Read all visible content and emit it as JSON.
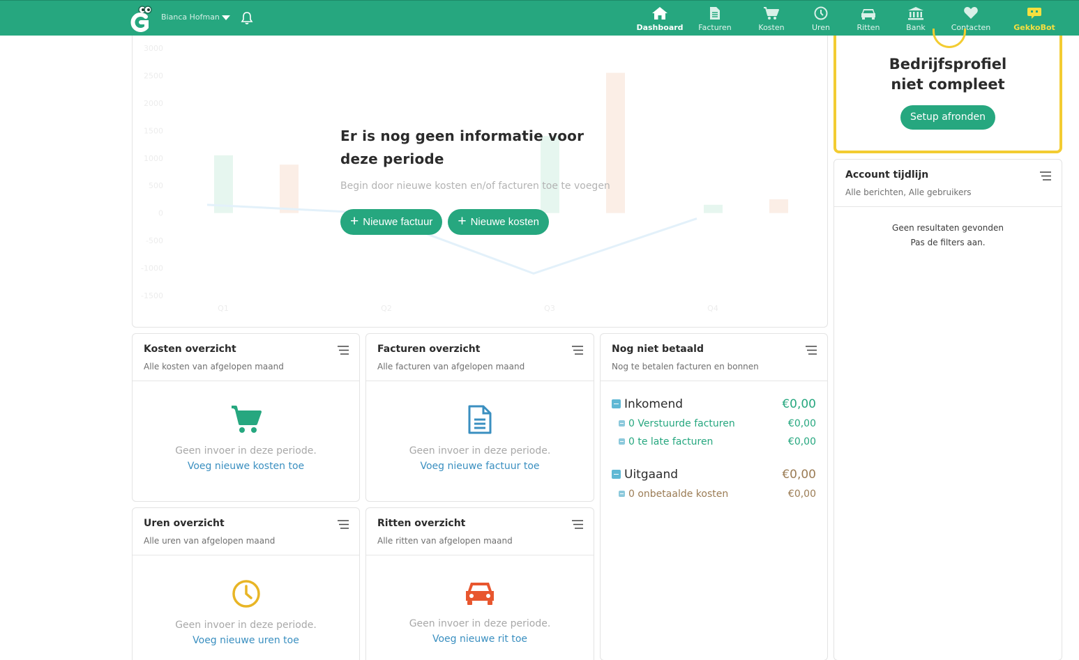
{
  "topbar": {
    "user_name": "Bianca Hofman",
    "nav": [
      {
        "label": "Dashboard",
        "icon": "home-icon"
      },
      {
        "label": "Facturen",
        "icon": "document-icon"
      },
      {
        "label": "Kosten",
        "icon": "cart-icon"
      },
      {
        "label": "Uren",
        "icon": "clock-icon"
      },
      {
        "label": "Ritten",
        "icon": "car-icon"
      },
      {
        "label": "Bank",
        "icon": "bank-icon"
      },
      {
        "label": "Contacten",
        "icon": "heart-icon"
      },
      {
        "label": "GekkoBot",
        "icon": "robot-icon"
      }
    ],
    "active": "Dashboard"
  },
  "colors": {
    "brand": "#26a77f",
    "accent_yellow": "#f3cc32",
    "link": "#3a8fc0",
    "expense_brown": "#9b7c55"
  },
  "chart_data": {
    "type": "bar",
    "categories": [
      "Q1",
      "Q2",
      "Q3",
      "Q4"
    ],
    "series": [
      {
        "values": [
          1050,
          0,
          1400,
          150
        ]
      },
      {
        "values": [
          880,
          0,
          2550,
          250
        ]
      }
    ],
    "line": [
      150,
      0,
      -1100,
      -100
    ],
    "yticks": [
      "3000",
      "2500",
      "2000",
      "1500",
      "1000",
      "500",
      "0",
      "-500",
      "-1000",
      "-1500"
    ],
    "ylim": [
      -1500,
      3000
    ],
    "faded": true
  },
  "empty_state": {
    "title": "Er is nog geen informatie voor deze periode",
    "subtitle": "Begin door nieuwe kosten en/of facturen toe te voegen",
    "new_invoice": "Nieuwe factuur",
    "new_costs": "Nieuwe kosten"
  },
  "cards": {
    "kosten": {
      "title": "Kosten overzicht",
      "sub": "Alle kosten van afgelopen maand",
      "empty": "Geen invoer in deze periode.",
      "link": "Voeg nieuwe kosten toe"
    },
    "facturen": {
      "title": "Facturen overzicht",
      "sub": "Alle facturen van afgelopen maand",
      "empty": "Geen invoer in deze periode.",
      "link": "Voeg nieuwe factuur toe"
    },
    "uren": {
      "title": "Uren overzicht",
      "sub": "Alle uren van afgelopen maand",
      "empty": "Geen invoer in deze periode.",
      "link": "Voeg nieuwe uren toe"
    },
    "ritten": {
      "title": "Ritten overzicht",
      "sub": "Alle ritten van afgelopen maand",
      "empty": "Geen invoer in deze periode.",
      "link": "Voeg nieuwe rit toe"
    }
  },
  "unpaid": {
    "title": "Nog niet betaald",
    "sub": "Nog te betalen facturen en bonnen",
    "incoming": {
      "label": "Inkomend",
      "amount": "€0,00",
      "rows": [
        {
          "label": "0 Verstuurde facturen",
          "amount": "€0,00"
        },
        {
          "label": "0 te late facturen",
          "amount": "€0,00"
        }
      ]
    },
    "outgoing": {
      "label": "Uitgaand",
      "amount": "€0,00",
      "rows": [
        {
          "label": "0 onbetaalde kosten",
          "amount": "€0,00"
        }
      ]
    }
  },
  "setup": {
    "title": "Bedrijfsprofiel niet compleet",
    "button": "Setup afronden"
  },
  "timeline": {
    "title": "Account tijdlijn",
    "sub": "Alle berichten, Alle gebruikers",
    "empty_1": "Geen resultaten gevonden",
    "empty_2": "Pas de filters aan."
  }
}
